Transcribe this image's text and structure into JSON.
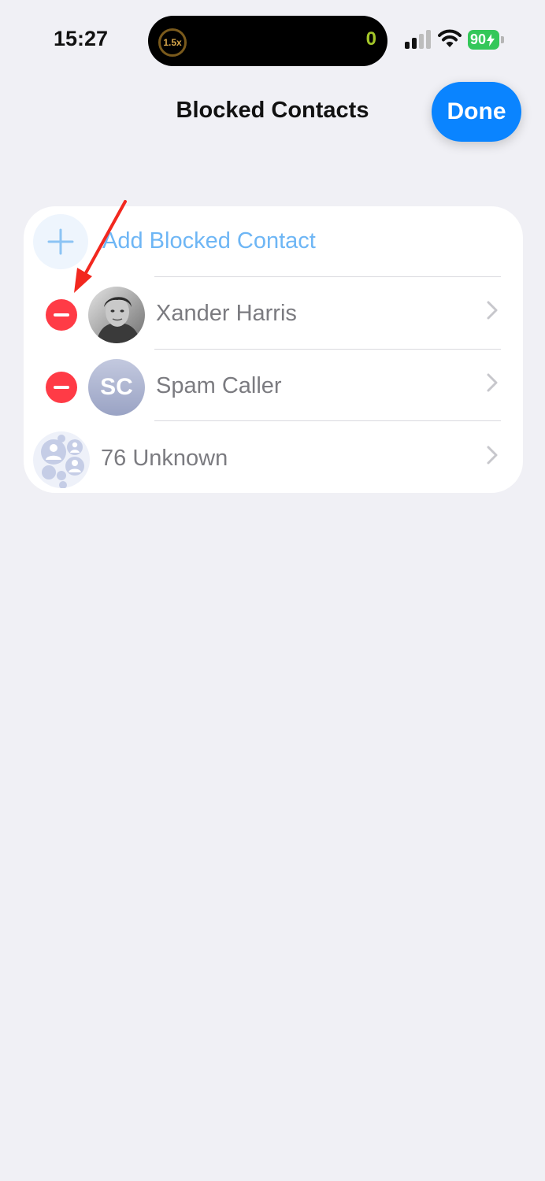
{
  "status_bar": {
    "time": "15:27",
    "playback_speed": "1.5x",
    "island_count": "0",
    "battery_level": "90"
  },
  "nav": {
    "title": "Blocked Contacts",
    "done_label": "Done"
  },
  "list": {
    "add_label": "Add Blocked Contact",
    "contacts": [
      {
        "name": "Xander Harris",
        "avatar": "photo"
      },
      {
        "name": "Spam Caller",
        "avatar_initials": "SC"
      }
    ],
    "unknown_label": "76 Unknown"
  },
  "colors": {
    "accent": "#0a84ff",
    "delete_red": "#ff3b46",
    "annotation_arrow": "#f2281f",
    "battery_green": "#34c759"
  }
}
